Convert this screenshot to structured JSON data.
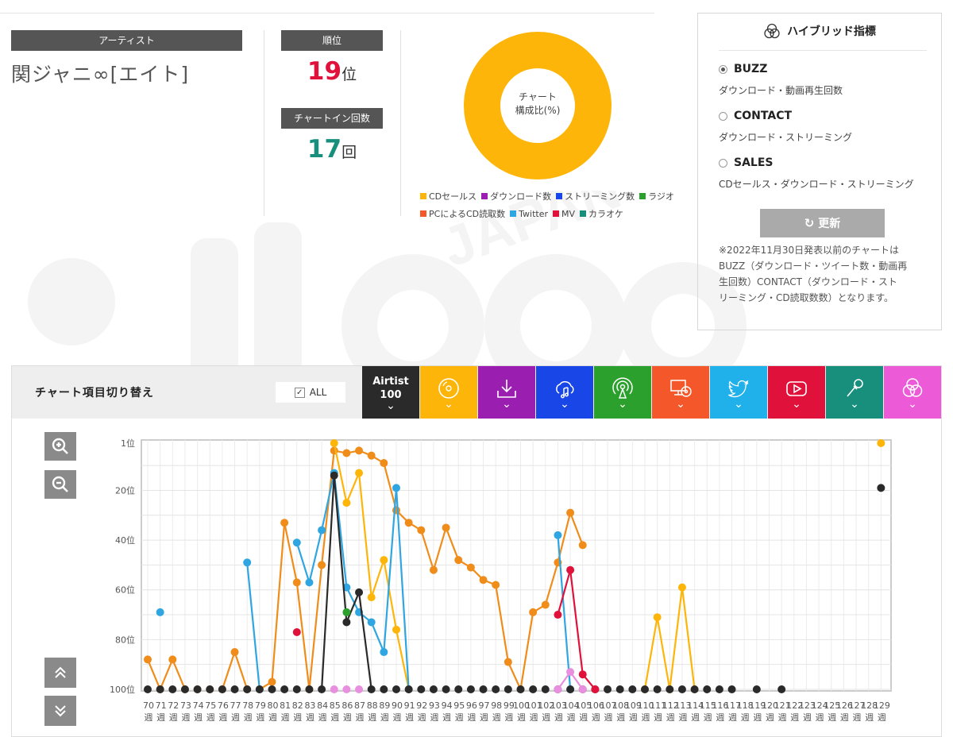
{
  "artist": {
    "header": "アーティスト",
    "name": "関ジャニ∞[エイト]"
  },
  "rank": {
    "header": "順位",
    "value": "19",
    "unit": "位"
  },
  "chartin": {
    "header": "チャートイン回数",
    "value": "17",
    "unit": "回"
  },
  "donut": {
    "center_line1": "チャート",
    "center_line2": "構成比(%)",
    "color": "#fdb509"
  },
  "legend": [
    {
      "label": "CDセールス",
      "color": "#fdb509"
    },
    {
      "label": "ダウンロード数",
      "color": "#9a1fb0"
    },
    {
      "label": "ストリーミング数",
      "color": "#1946e6"
    },
    {
      "label": "ラジオ",
      "color": "#2ca02c"
    },
    {
      "label": "PCによるCD読取数",
      "color": "#f4582a"
    },
    {
      "label": "Twitter",
      "color": "#2fa6e1"
    },
    {
      "label": "MV",
      "color": "#e0123c"
    },
    {
      "label": "カラオケ",
      "color": "#178f7c"
    }
  ],
  "hybrid": {
    "title": "ハイブリッド指標",
    "options": [
      {
        "label": "BUZZ",
        "desc": "ダウンロード・動画再生回数",
        "selected": true
      },
      {
        "label": "CONTACT",
        "desc": "ダウンロード・ストリーミング",
        "selected": false
      },
      {
        "label": "SALES",
        "desc": "CDセールス・ダウンロード・ストリーミング",
        "selected": false
      }
    ],
    "update_label": "更新",
    "note_lines": [
      "※2022年11月30日発表以前のチャートは",
      "BUZZ（ダウンロード・ツイート数・動画再",
      "生回数）CONTACT（ダウンロード・スト",
      "リーミング・CD読取数数）となります。"
    ]
  },
  "switcher": {
    "title": "チャート項目切り替え",
    "all_label": "ALL",
    "all_checked": true
  },
  "tabs": [
    {
      "label1": "Airtist",
      "label2": "100",
      "color": "#2a2a2a",
      "icon": "text"
    },
    {
      "color": "#fdb509",
      "icon": "cd-icon"
    },
    {
      "color": "#9a1fb0",
      "icon": "download-icon"
    },
    {
      "color": "#1946e6",
      "icon": "cloud-music-icon"
    },
    {
      "color": "#2ca02c",
      "icon": "radio-icon"
    },
    {
      "color": "#f4582a",
      "icon": "pc-cd-icon"
    },
    {
      "color": "#20b0ea",
      "icon": "twitter-icon"
    },
    {
      "color": "#e0123c",
      "icon": "youtube-icon"
    },
    {
      "color": "#178f7c",
      "icon": "microphone-icon"
    },
    {
      "color": "#ec5ad8",
      "icon": "hybrid-icon"
    }
  ],
  "chart_data": {
    "type": "line",
    "yticks": [
      "1位",
      "20位",
      "40位",
      "60位",
      "80位",
      "100位"
    ],
    "ylim": [
      1,
      100
    ],
    "inverted": true,
    "x_numbers": [
      "70",
      "71",
      "72",
      "73",
      "74",
      "75",
      "76",
      "77",
      "78",
      "79",
      "80",
      "81",
      "82",
      "83",
      "84",
      "85",
      "86",
      "87",
      "88",
      "89",
      "90",
      "91",
      "92",
      "93",
      "94",
      "95",
      "96",
      "97",
      "98",
      "99",
      "100",
      "101",
      "102",
      "103",
      "104",
      "105",
      "106",
      "107",
      "108",
      "109",
      "110",
      "111",
      "112",
      "113",
      "114",
      "115",
      "116",
      "117",
      "118",
      "119",
      "120",
      "121",
      "122",
      "123",
      "124",
      "125",
      "126",
      "127",
      "128",
      "129"
    ],
    "x_suffix": "週",
    "series": [
      {
        "color": "#f08c1a",
        "values": [
          88,
          100,
          88,
          100,
          100,
          100,
          100,
          85,
          100,
          100,
          97,
          33,
          57,
          100,
          50,
          4,
          5,
          4,
          6,
          9,
          28,
          33,
          36,
          52,
          35,
          48,
          51,
          56,
          58,
          89,
          100,
          69,
          66,
          49,
          29,
          42,
          null,
          null,
          null,
          null,
          null,
          null,
          null,
          null,
          null,
          null,
          null,
          null,
          null,
          null,
          null,
          null,
          null,
          null,
          null,
          null,
          null,
          null,
          null,
          null
        ]
      },
      {
        "color": "#fdb509",
        "values": [
          null,
          null,
          null,
          null,
          null,
          null,
          null,
          null,
          null,
          null,
          null,
          null,
          null,
          null,
          null,
          1,
          25,
          13,
          63,
          48,
          76,
          100,
          null,
          null,
          null,
          null,
          null,
          null,
          null,
          null,
          null,
          null,
          null,
          null,
          null,
          null,
          null,
          null,
          null,
          null,
          100,
          71,
          100,
          59,
          100,
          null,
          null,
          null,
          null,
          null,
          null,
          null,
          null,
          null,
          null,
          null,
          null,
          null,
          null,
          1
        ]
      },
      {
        "color": "#2fa6e1",
        "values": [
          null,
          69,
          null,
          null,
          null,
          null,
          null,
          null,
          49,
          100,
          null,
          null,
          41,
          57,
          36,
          13,
          59,
          69,
          73,
          85,
          19,
          100,
          null,
          null,
          null,
          null,
          null,
          null,
          null,
          null,
          null,
          null,
          null,
          38,
          100,
          null,
          null,
          null,
          null,
          null,
          null,
          null,
          null,
          null,
          null,
          null,
          null,
          null,
          null,
          null,
          null,
          null,
          null,
          null,
          null,
          null,
          null,
          null,
          null,
          null
        ]
      },
      {
        "color": "#2a2a2a",
        "values": [
          100,
          100,
          100,
          100,
          100,
          100,
          100,
          100,
          100,
          100,
          100,
          100,
          100,
          100,
          100,
          14,
          73,
          61,
          100,
          100,
          100,
          100,
          100,
          100,
          100,
          100,
          100,
          100,
          100,
          100,
          100,
          100,
          100,
          100,
          100,
          100,
          100,
          100,
          100,
          100,
          100,
          100,
          100,
          100,
          100,
          100,
          100,
          100,
          null,
          100,
          null,
          100,
          null,
          null,
          null,
          null,
          null,
          null,
          null,
          19
        ]
      },
      {
        "color": "#e0123c",
        "values": [
          null,
          null,
          null,
          null,
          null,
          null,
          null,
          null,
          null,
          null,
          null,
          null,
          77,
          null,
          null,
          null,
          null,
          null,
          null,
          null,
          null,
          null,
          null,
          null,
          null,
          null,
          null,
          null,
          null,
          null,
          null,
          null,
          null,
          70,
          52,
          94,
          100,
          null,
          null,
          null,
          null,
          null,
          null,
          null,
          null,
          null,
          null,
          null,
          null,
          null,
          null,
          null,
          null,
          null,
          null,
          null,
          null,
          null,
          null,
          null
        ]
      },
      {
        "color": "#2ca02c",
        "values": [
          null,
          null,
          null,
          null,
          null,
          null,
          null,
          null,
          null,
          null,
          null,
          null,
          null,
          null,
          null,
          null,
          69,
          null,
          null,
          null,
          null,
          null,
          null,
          null,
          null,
          null,
          null,
          null,
          null,
          null,
          null,
          null,
          null,
          null,
          null,
          null,
          null,
          null,
          null,
          null,
          null,
          null,
          null,
          null,
          null,
          null,
          null,
          null,
          null,
          null,
          null,
          null,
          null,
          null,
          null,
          null,
          null,
          null,
          null,
          null
        ]
      },
      {
        "color": "#e98fe0",
        "values": [
          null,
          null,
          null,
          null,
          null,
          null,
          null,
          null,
          null,
          null,
          null,
          null,
          null,
          null,
          null,
          100,
          100,
          100,
          null,
          null,
          null,
          null,
          null,
          null,
          null,
          null,
          null,
          null,
          null,
          null,
          null,
          null,
          null,
          100,
          93,
          100,
          null,
          null,
          null,
          null,
          null,
          null,
          null,
          null,
          null,
          null,
          null,
          null,
          null,
          null,
          null,
          null,
          null,
          null,
          null,
          null,
          null,
          null,
          null,
          null
        ]
      }
    ]
  }
}
